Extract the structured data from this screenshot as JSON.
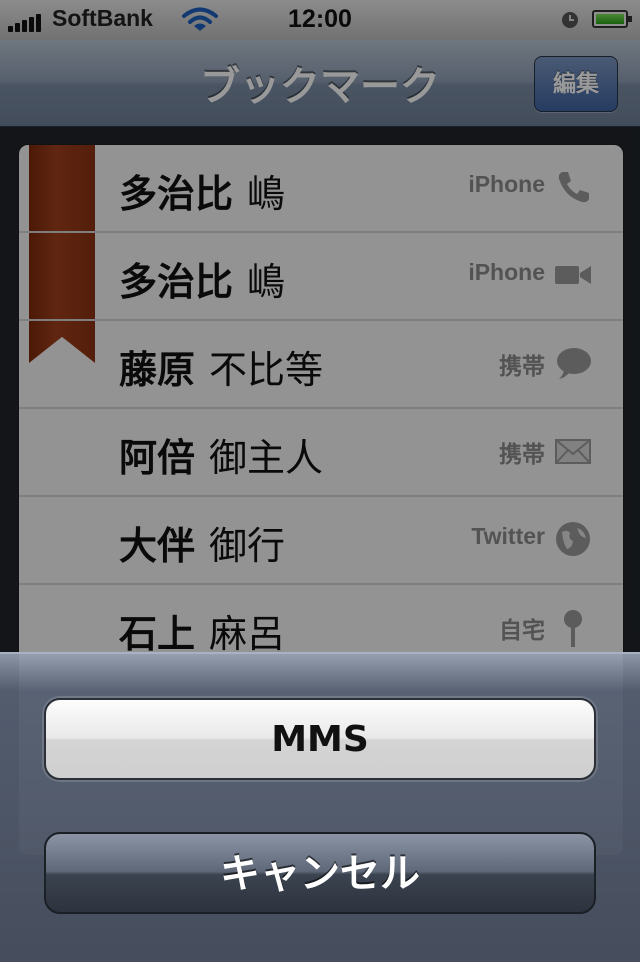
{
  "status_bar": {
    "carrier": "SoftBank",
    "time": "12:00"
  },
  "nav": {
    "title": "ブックマーク",
    "edit_label": "編集"
  },
  "bookmarks": [
    {
      "last": "多治比",
      "first": "嶋",
      "label": "iPhone",
      "icon": "phone-icon"
    },
    {
      "last": "多治比",
      "first": "嶋",
      "label": "iPhone",
      "icon": "video-icon"
    },
    {
      "last": "藤原",
      "first": "不比等",
      "label": "携帯",
      "icon": "message-icon"
    },
    {
      "last": "阿倍",
      "first": "御主人",
      "label": "携帯",
      "icon": "mail-icon"
    },
    {
      "last": "大伴",
      "first": "御行",
      "label": "Twitter",
      "icon": "globe-icon"
    },
    {
      "last": "石上",
      "first": "麻呂",
      "label": "自宅",
      "icon": "map-pin-icon"
    }
  ],
  "action_sheet": {
    "primary_label": "MMS",
    "cancel_label": "キャンセル"
  },
  "colors": {
    "ribbon": "#8c3313",
    "nav_accent": "#3f64a2",
    "battery": "#2aa51c"
  }
}
